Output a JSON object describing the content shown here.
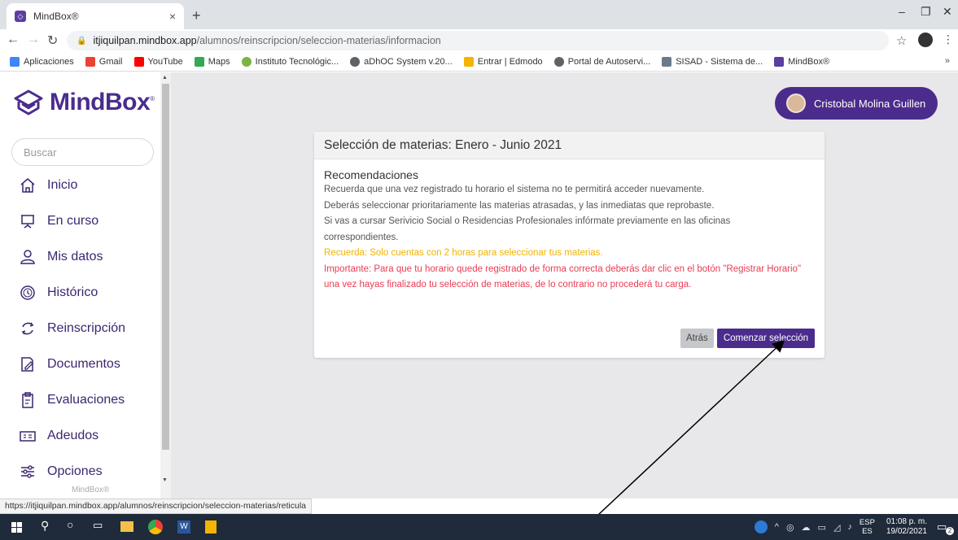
{
  "browser": {
    "tab_title": "MindBox®",
    "tab_close": "×",
    "new_tab": "+",
    "url_host": "itjiquilpan.mindbox.app",
    "url_path": "/alumnos/reinscripcion/seleccion-materias/informacion",
    "bookmarks": [
      {
        "label": "Aplicaciones",
        "color": "#4285f4"
      },
      {
        "label": "Gmail",
        "color": "#ea4335"
      },
      {
        "label": "YouTube",
        "color": "#ff0000"
      },
      {
        "label": "Maps",
        "color": "#34a853"
      },
      {
        "label": "Instituto Tecnológic...",
        "color": "#7cb342"
      },
      {
        "label": "aDhOC System v.20...",
        "color": "#5f6368"
      },
      {
        "label": "Entrar | Edmodo",
        "color": "#f5b400"
      },
      {
        "label": "Portal de Autoservi...",
        "color": "#5f6368"
      },
      {
        "label": "SISAD - Sistema de...",
        "color": "#6b7b8c"
      },
      {
        "label": "MindBox®",
        "color": "#5a3fa0"
      }
    ],
    "bookmarks_more": "»"
  },
  "sidebar": {
    "logo_text": "MindBox",
    "search_placeholder": "Buscar",
    "items": [
      {
        "label": "Inicio",
        "icon": "home-icon"
      },
      {
        "label": "En curso",
        "icon": "presentation-icon"
      },
      {
        "label": "Mis datos",
        "icon": "user-icon"
      },
      {
        "label": "Histórico",
        "icon": "history-clock-icon"
      },
      {
        "label": "Reinscripción",
        "icon": "refresh-icon"
      },
      {
        "label": "Documentos",
        "icon": "document-edit-icon"
      },
      {
        "label": "Evaluaciones",
        "icon": "clipboard-icon"
      },
      {
        "label": "Adeudos",
        "icon": "money-icon"
      },
      {
        "label": "Opciones",
        "icon": "sliders-icon"
      }
    ],
    "footer": "MindBox®"
  },
  "header": {
    "user_name": "Cristobal Molina Guillen"
  },
  "card": {
    "title": "Selección de materias: Enero - Junio 2021",
    "rec_title": "Recomendaciones",
    "line1": "Recuerda que una vez registrado tu horario el sistema no te permitirá acceder nuevamente.",
    "line2": "Deberás seleccionar prioritariamente las materias atrasadas, y las inmediatas que reprobaste.",
    "line3": "Si vas a cursar Serivicio Social o Residencias Profesionales infórmate previamente en las oficinas correspondientes.",
    "line4": "Recuerda: Solo cuentas con 2 horas para seleccionar tus materias.",
    "line5": "Importante: Para que tu horario quede registrado de forma correcta deberás dar clic en el botón \"Registrar Horario\" una vez hayas finalizado tu selección de materias, de lo contrario no procederá tu carga.",
    "back_label": "Atrás",
    "start_label": "Comenzar selección"
  },
  "status_url": "https://itjiquilpan.mindbox.app/alumnos/reinscripcion/seleccion-materias/reticula",
  "taskbar": {
    "lang_top": "ESP",
    "lang_bottom": "ES",
    "time": "01:08 p. m.",
    "date": "19/02/2021",
    "notifications": "2"
  },
  "colors": {
    "brand": "#4b2c8c",
    "warning": "#f0b400",
    "danger": "#ea3c53"
  }
}
